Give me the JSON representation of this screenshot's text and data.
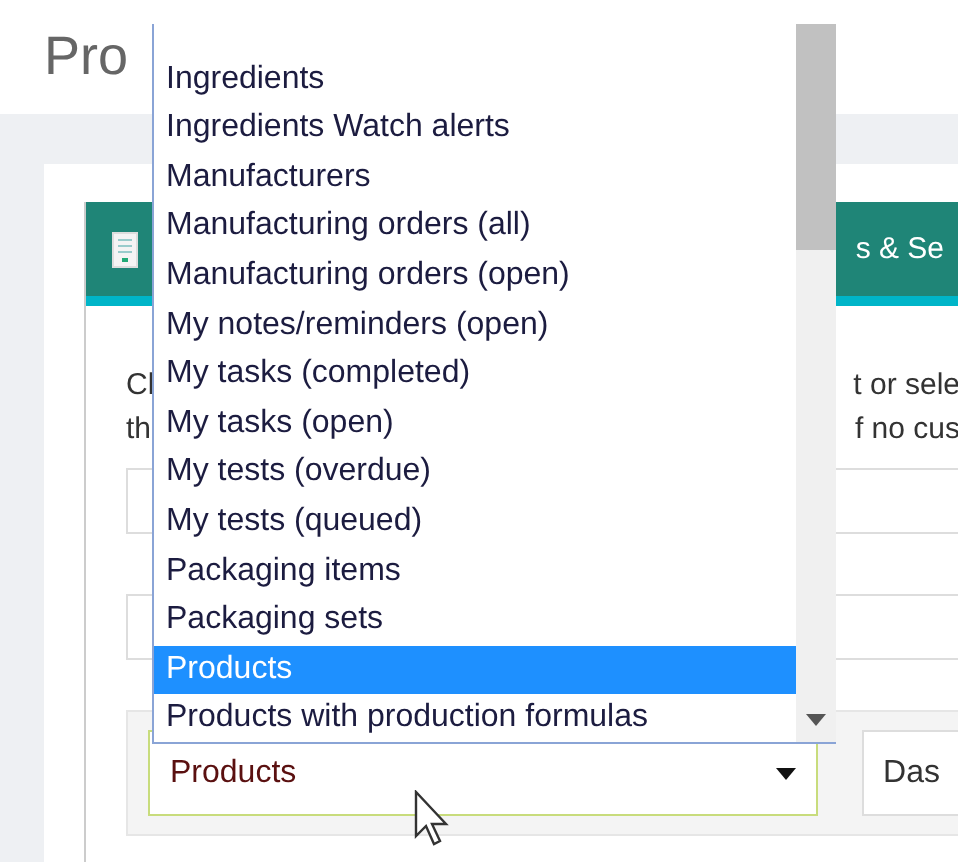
{
  "page_title": "Pro",
  "card": {
    "tab_label": "s & Se",
    "text_lines": [
      {
        "left": "Cl",
        "right": "t or sele"
      },
      {
        "left": "th",
        "right": "f no cus"
      }
    ],
    "report_select": {
      "value": "Products"
    },
    "second_select": {
      "value": "Das"
    }
  },
  "dropdown": {
    "items": [
      {
        "label": "Ingredients",
        "selected": false
      },
      {
        "label": "Ingredients Watch alerts",
        "selected": false
      },
      {
        "label": "Manufacturers",
        "selected": false
      },
      {
        "label": "Manufacturing orders (all)",
        "selected": false
      },
      {
        "label": "Manufacturing orders (open)",
        "selected": false
      },
      {
        "label": "My notes/reminders (open)",
        "selected": false
      },
      {
        "label": "My tasks (completed)",
        "selected": false
      },
      {
        "label": "My tasks (open)",
        "selected": false
      },
      {
        "label": "My tests (overdue)",
        "selected": false
      },
      {
        "label": "My tests (queued)",
        "selected": false
      },
      {
        "label": "Packaging items",
        "selected": false
      },
      {
        "label": "Packaging sets",
        "selected": false
      },
      {
        "label": "Products",
        "selected": true
      },
      {
        "label": "Products with production formulas",
        "selected": false
      }
    ]
  }
}
